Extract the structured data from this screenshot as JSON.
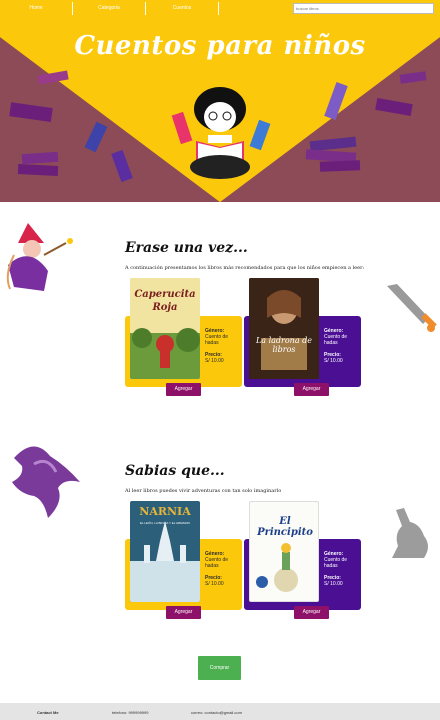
{
  "nav": {
    "items": [
      "Home",
      "Categoria",
      "Cuentos"
    ],
    "search_placeholder": "buscar libros"
  },
  "hero": {
    "title": "Cuentos para niños"
  },
  "section1": {
    "title": "Erase una vez...",
    "description": "A continuación presentamos los libros más recomendados para que los niños empiecen a leer:",
    "books": [
      {
        "cover_title": "Caperucita Roja",
        "genre_label": "Género:",
        "genre": "Cuento de hadas",
        "price_label": "Precio:",
        "price": "S/ 10.00",
        "button": "Agregar"
      },
      {
        "cover_title": "La ladrona de libros",
        "genre_label": "Género:",
        "genre": "Cuento de hadas",
        "price_label": "Precio:",
        "price": "S/ 10.00",
        "button": "Agregar"
      }
    ]
  },
  "section2": {
    "title": "Sabias que...",
    "description": "Al leer libros puedes vivir adventuras con tan solo imaginarlo",
    "books": [
      {
        "cover_title": "NARNIA",
        "cover_subtitle": "EL LEÓN, LA BRUJA Y EL ARMARIO",
        "genre_label": "Género:",
        "genre": "Cuento de hadas",
        "price_label": "Precio:",
        "price": "S/ 10.00",
        "button": "Agregar"
      },
      {
        "cover_title": "El Principito",
        "genre_label": "Género:",
        "genre": "Cuento de hadas",
        "price_label": "Precio:",
        "price": "S/ 10.00",
        "button": "Agregar"
      }
    ]
  },
  "buy_button": "Comprar",
  "footer": {
    "contact": "Contact Me",
    "phone": "telefono: 999999999",
    "email": "correo: contacto@gmail.com"
  },
  "colors": {
    "accent": "#fbc80b",
    "hero_bg": "#8c4b57",
    "purple": "#4b0f94",
    "button": "#8d1069",
    "buy": "#4caf50"
  }
}
